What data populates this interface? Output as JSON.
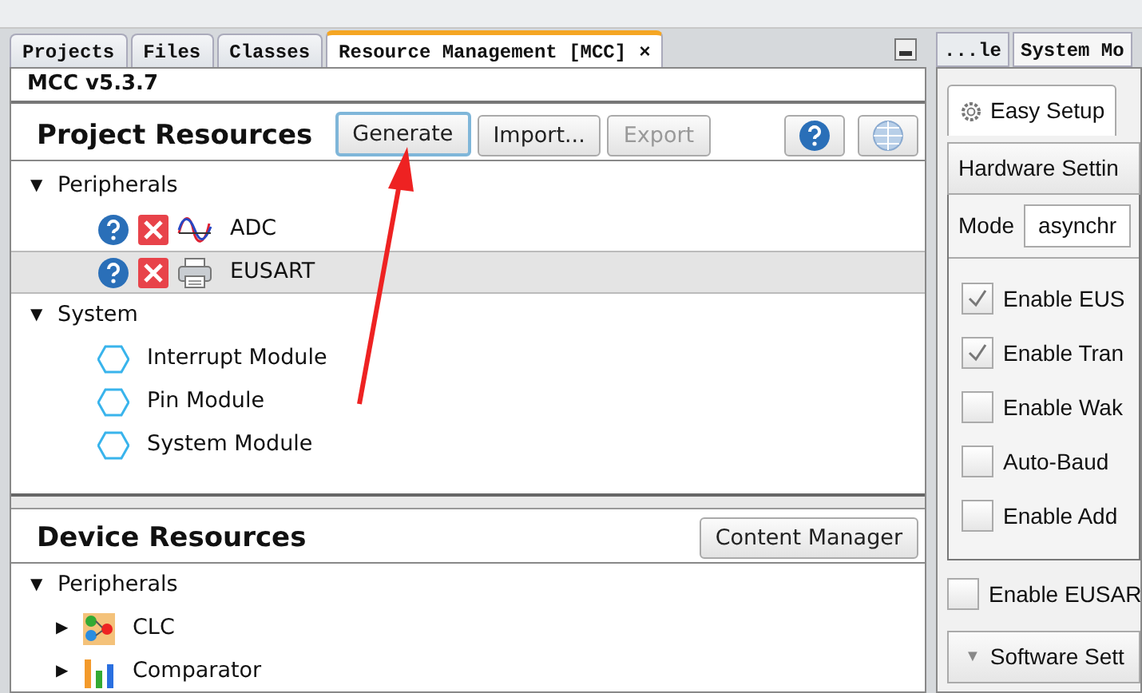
{
  "left_tabs": [
    {
      "label": "Projects",
      "selected": false
    },
    {
      "label": "Files",
      "selected": false
    },
    {
      "label": "Classes",
      "selected": false
    },
    {
      "label": "Resource Management [MCC]",
      "selected": true,
      "close": "×"
    }
  ],
  "version": "MCC v5.3.7",
  "project_resources": {
    "title": "Project Resources",
    "buttons": [
      {
        "label": "Generate",
        "disabled": false,
        "focused": true
      },
      {
        "label": "Import...",
        "disabled": false,
        "focused": false
      },
      {
        "label": "Export",
        "disabled": true,
        "focused": false
      }
    ],
    "tree": [
      {
        "label": "Peripherals",
        "toggle": "▼",
        "children": [
          {
            "label": "ADC",
            "kind": "wave",
            "selected": false
          },
          {
            "label": "EUSART",
            "kind": "printer",
            "selected": true
          }
        ]
      },
      {
        "label": "System",
        "toggle": "▼",
        "children": [
          {
            "label": "Interrupt Module",
            "kind": "hexagon",
            "selected": false
          },
          {
            "label": "Pin Module",
            "kind": "hexagon",
            "selected": false
          },
          {
            "label": "System Module",
            "kind": "hexagon",
            "selected": false
          }
        ]
      }
    ]
  },
  "device_resources": {
    "title": "Device Resources",
    "button": "Content Manager",
    "tree": [
      {
        "label": "Peripherals",
        "toggle": "▼",
        "children": [
          {
            "label": "CLC",
            "kind": "logic",
            "toggle": "▶"
          },
          {
            "label": "Comparator",
            "kind": "bars",
            "toggle": "▶"
          }
        ]
      }
    ]
  },
  "right_tabs": [
    {
      "label": "...le",
      "selected": false
    },
    {
      "label": "System Mo",
      "selected": true
    }
  ],
  "setup_tabs": [
    {
      "label": "Easy Setup",
      "selected": true
    }
  ],
  "hardware_settings": {
    "title": "Hardware Settin",
    "mode_label": "Mode",
    "mode_value": "asynchr",
    "options": [
      {
        "label": "Enable EUS",
        "checked": true
      },
      {
        "label": "Enable Tran",
        "checked": true
      },
      {
        "label": "Enable Wak",
        "checked": false
      },
      {
        "label": "Auto-Baud",
        "checked": false
      },
      {
        "label": "Enable Add",
        "checked": false
      }
    ]
  },
  "interrupt_option": {
    "label": "Enable EUSAR",
    "checked": false
  },
  "software_settings": {
    "title": "Software Sett",
    "toggle": "▼"
  }
}
